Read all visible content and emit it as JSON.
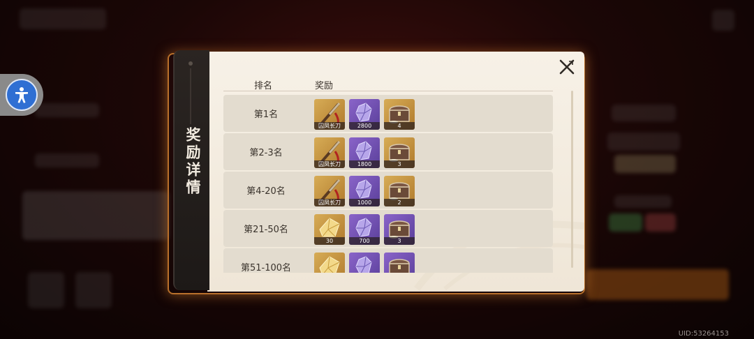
{
  "dialog": {
    "title": "奖励详情",
    "col_rank": "排名",
    "col_reward": "奖励"
  },
  "rows": [
    {
      "rank": "第1名",
      "items": [
        {
          "icon": "sword-icon",
          "type": "gold",
          "label": "囚凤长刀"
        },
        {
          "icon": "crystal-icon",
          "type": "purple",
          "label": "2800"
        },
        {
          "icon": "chest-icon",
          "type": "gold",
          "label": "4"
        }
      ]
    },
    {
      "rank": "第2-3名",
      "items": [
        {
          "icon": "sword-icon",
          "type": "gold",
          "label": "囚凤长刀"
        },
        {
          "icon": "crystal-icon",
          "type": "purple",
          "label": "1800"
        },
        {
          "icon": "chest-icon",
          "type": "gold",
          "label": "3"
        }
      ]
    },
    {
      "rank": "第4-20名",
      "items": [
        {
          "icon": "sword-icon",
          "type": "gold",
          "label": "囚凤长刀"
        },
        {
          "icon": "crystal-icon",
          "type": "purple",
          "label": "1000"
        },
        {
          "icon": "chest-icon",
          "type": "gold",
          "label": "2"
        }
      ]
    },
    {
      "rank": "第21-50名",
      "items": [
        {
          "icon": "gold-crystal-icon",
          "type": "gold",
          "label": "30"
        },
        {
          "icon": "crystal-icon",
          "type": "purple",
          "label": "700"
        },
        {
          "icon": "chest-icon",
          "type": "purple",
          "label": "3"
        }
      ]
    },
    {
      "rank": "第51-100名",
      "items": [
        {
          "icon": "gold-crystal-icon",
          "type": "gold",
          "label": ""
        },
        {
          "icon": "crystal-icon",
          "type": "purple",
          "label": ""
        },
        {
          "icon": "chest-icon",
          "type": "purple",
          "label": ""
        }
      ]
    }
  ],
  "footer": {
    "uid": "UID:53264153"
  },
  "colors": {
    "accent_border": "#b8702b",
    "panel": "#f7f1e7",
    "row": "#e3dccf",
    "a11y": "#2f6fd3"
  }
}
